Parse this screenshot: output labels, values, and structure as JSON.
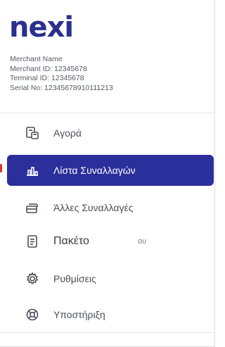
{
  "brand": {
    "logo_text": "nexi",
    "color": "#2b2f8f"
  },
  "merchant": {
    "name": "Merchant Name",
    "merchant_id": "Merchant ID: 12345678",
    "terminal_id": "Terminal ID: 12345678",
    "serial_no": "Serial No: 12345678910111213"
  },
  "menu": {
    "active_color": "#2b2f9c",
    "items": [
      {
        "label": "Αγορά",
        "icon": "card-terminal-icon",
        "active": false
      },
      {
        "label": "Λίστα Συναλλαγών",
        "icon": "bar-chart-icon",
        "active": true
      },
      {
        "label": "Άλλες Συναλλαγές",
        "icon": "stacked-cards-icon",
        "active": false
      },
      {
        "label": "Πακέτο",
        "icon": "document-icon",
        "active": false,
        "overlay_text": "ου"
      },
      {
        "label": "Ρυθμίσεις",
        "icon": "gear-icon",
        "active": false
      },
      {
        "label": "Υποστήριξη",
        "icon": "lifebuoy-icon",
        "active": false
      }
    ]
  }
}
